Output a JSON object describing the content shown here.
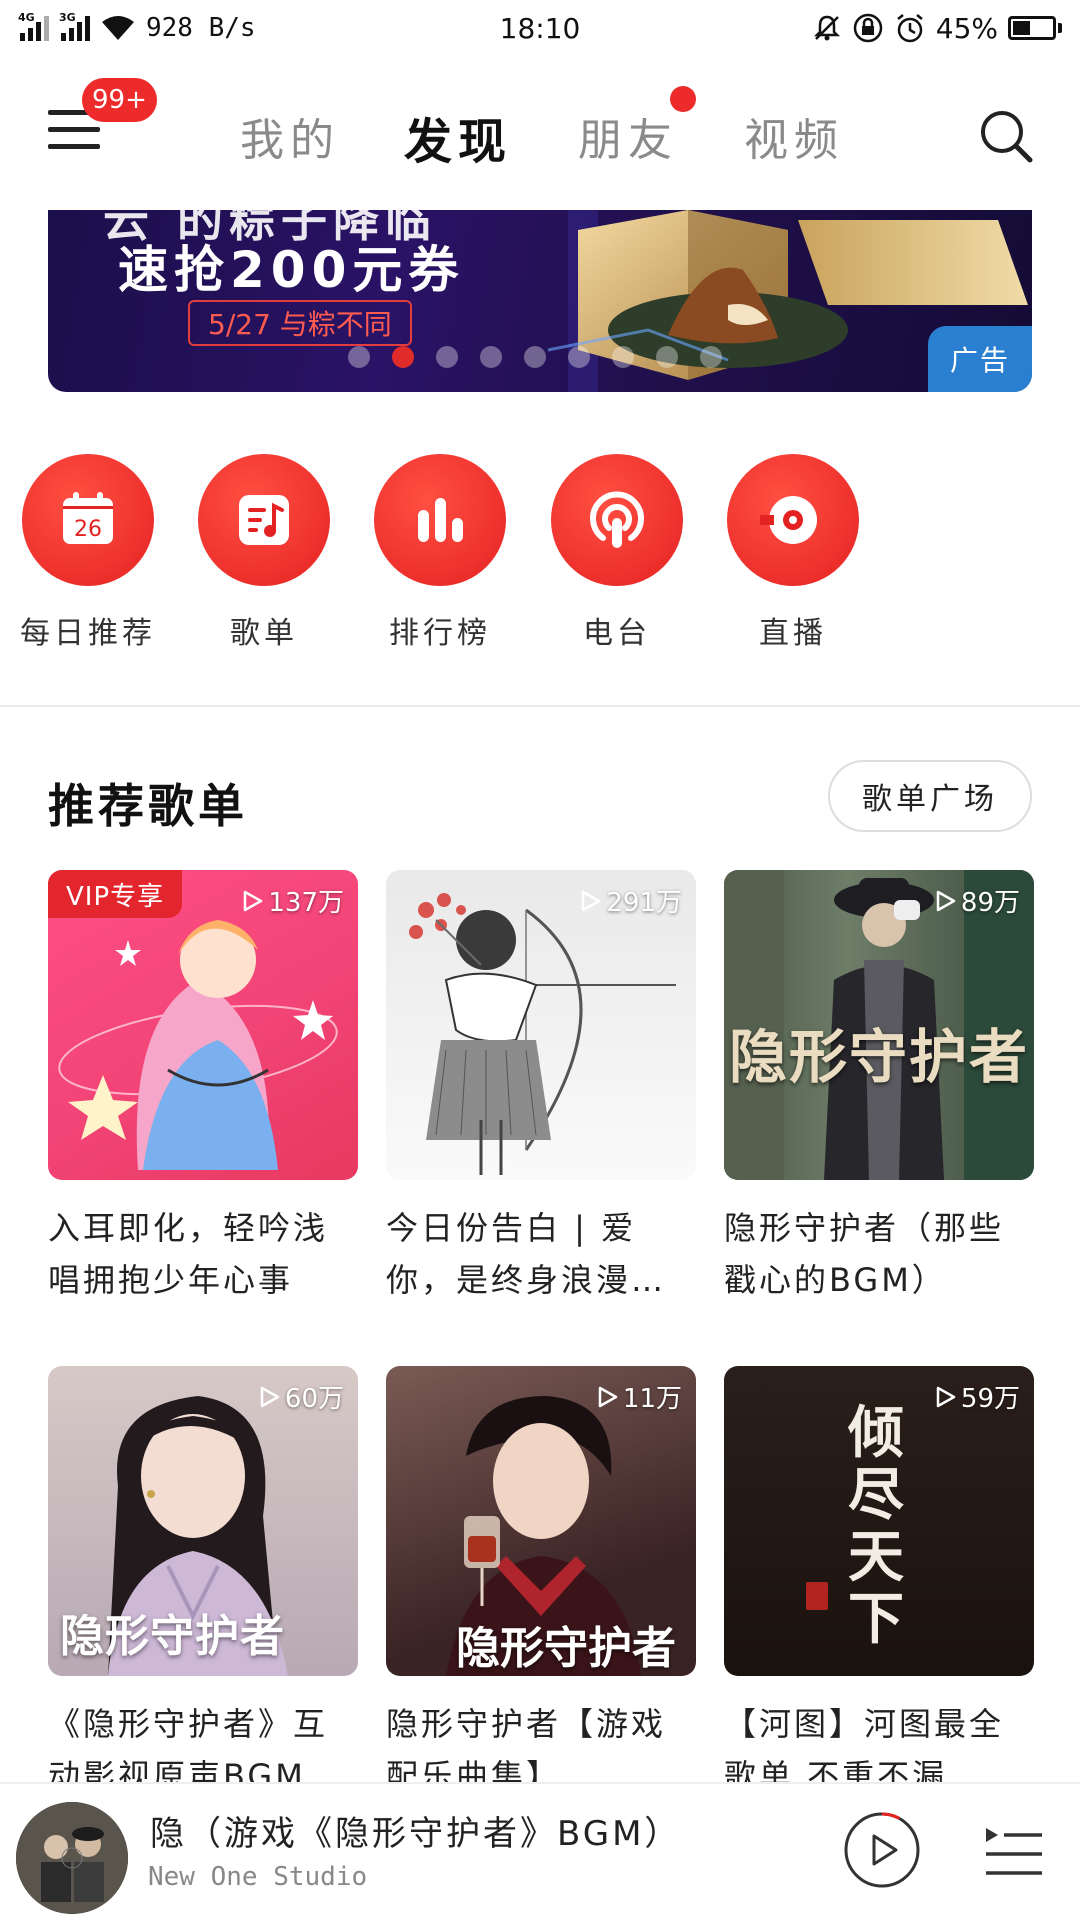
{
  "status_bar": {
    "net_label_1": "4G",
    "net_label_2": "3G",
    "speed": "928 B/s",
    "time": "18:10",
    "battery": "45%",
    "battery_level": 0.45
  },
  "header": {
    "badge": "99+",
    "tabs": [
      {
        "label": "我的"
      },
      {
        "label": "发现"
      },
      {
        "label": "朋友"
      },
      {
        "label": "视频"
      }
    ],
    "active_tab": 1
  },
  "banner": {
    "partial_text": "云 的粽子降临",
    "headline": "速抢200元券",
    "date_pill": "5/27 与粽不同",
    "ad_label": "广告",
    "dot_count": 9,
    "active_dot": 1
  },
  "quick_entries": [
    {
      "label": "每日推荐",
      "icon": "calendar-icon",
      "day": "26"
    },
    {
      "label": "歌单",
      "icon": "playlist-icon"
    },
    {
      "label": "排行榜",
      "icon": "chart-icon"
    },
    {
      "label": "电台",
      "icon": "radio-icon"
    },
    {
      "label": "直播",
      "icon": "live-icon"
    }
  ],
  "section": {
    "title": "推荐歌单",
    "button": "歌单广场"
  },
  "playlists": [
    {
      "title": "入耳即化，轻吟浅唱拥抱少年心事",
      "plays": "137万",
      "vip": "VIP专享"
    },
    {
      "title": "今日份告白 | 爱你，是终身浪漫…",
      "plays": "291万"
    },
    {
      "title": "隐形守护者（那些戳心的BGM）",
      "plays": "89万",
      "cover_text": "隐形守护者"
    },
    {
      "title": "《隐形守护者》互动影视原声BGM…",
      "plays": "60万",
      "cover_text": "隐形守护者"
    },
    {
      "title": "隐形守护者【游戏配乐曲集】",
      "plays": "11万",
      "cover_text": "隐形守护者"
    },
    {
      "title": "【河图】河图最全歌单 不重不漏",
      "plays": "59万",
      "cover_text": "倾尽天下"
    }
  ],
  "player": {
    "title": "隐（游戏《隐形守护者》BGM）",
    "artist": "New One Studio",
    "progress": 0.08
  },
  "colors": {
    "brand_red": "#e52222",
    "ad_blue": "#2a7fd0"
  }
}
